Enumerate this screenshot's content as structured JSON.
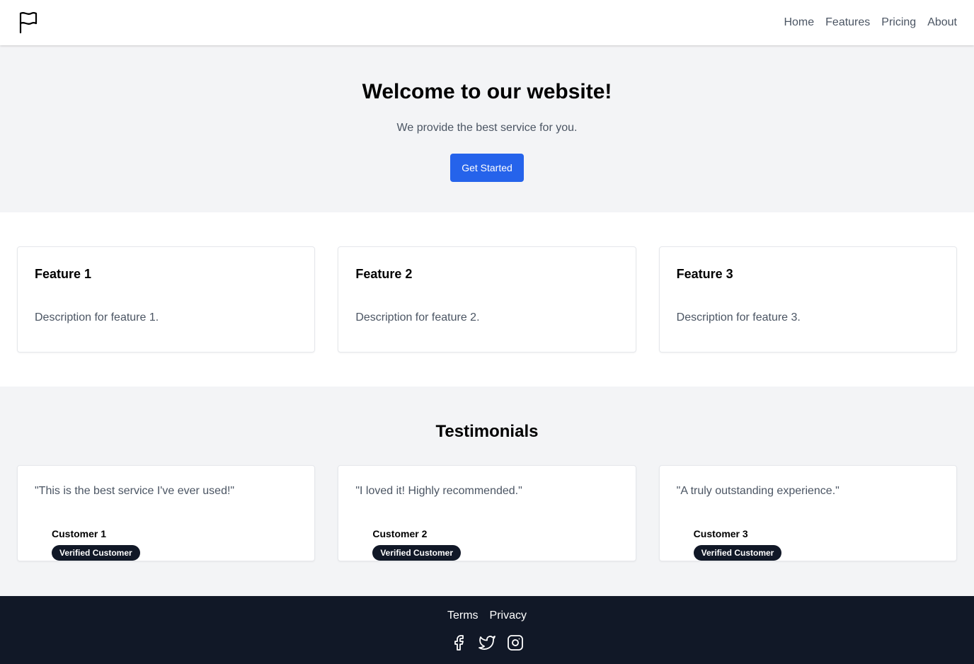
{
  "header": {
    "logo_icon": "flag-icon",
    "nav": [
      {
        "label": "Home"
      },
      {
        "label": "Features"
      },
      {
        "label": "Pricing"
      },
      {
        "label": "About"
      }
    ]
  },
  "hero": {
    "title": "Welcome to our website!",
    "subtitle": "We provide the best service for you.",
    "cta_label": "Get Started"
  },
  "features": [
    {
      "title": "Feature 1",
      "description": "Description for feature 1."
    },
    {
      "title": "Feature 2",
      "description": "Description for feature 2."
    },
    {
      "title": "Feature 3",
      "description": "Description for feature 3."
    }
  ],
  "testimonials": {
    "heading": "Testimonials",
    "items": [
      {
        "quote": "\"This is the best service I've ever used!\"",
        "name": "Customer 1",
        "badge": "Verified Customer"
      },
      {
        "quote": "\"I loved it! Highly recommended.\"",
        "name": "Customer 2",
        "badge": "Verified Customer"
      },
      {
        "quote": "\"A truly outstanding experience.\"",
        "name": "Customer 3",
        "badge": "Verified Customer"
      }
    ]
  },
  "footer": {
    "links": [
      {
        "label": "Terms"
      },
      {
        "label": "Privacy"
      }
    ],
    "socials": [
      "facebook-icon",
      "twitter-icon",
      "instagram-icon"
    ]
  },
  "colors": {
    "primary": "#2563eb",
    "footer_bg": "#111827",
    "section_bg": "#f3f4f6",
    "muted_text": "#4b5563"
  }
}
